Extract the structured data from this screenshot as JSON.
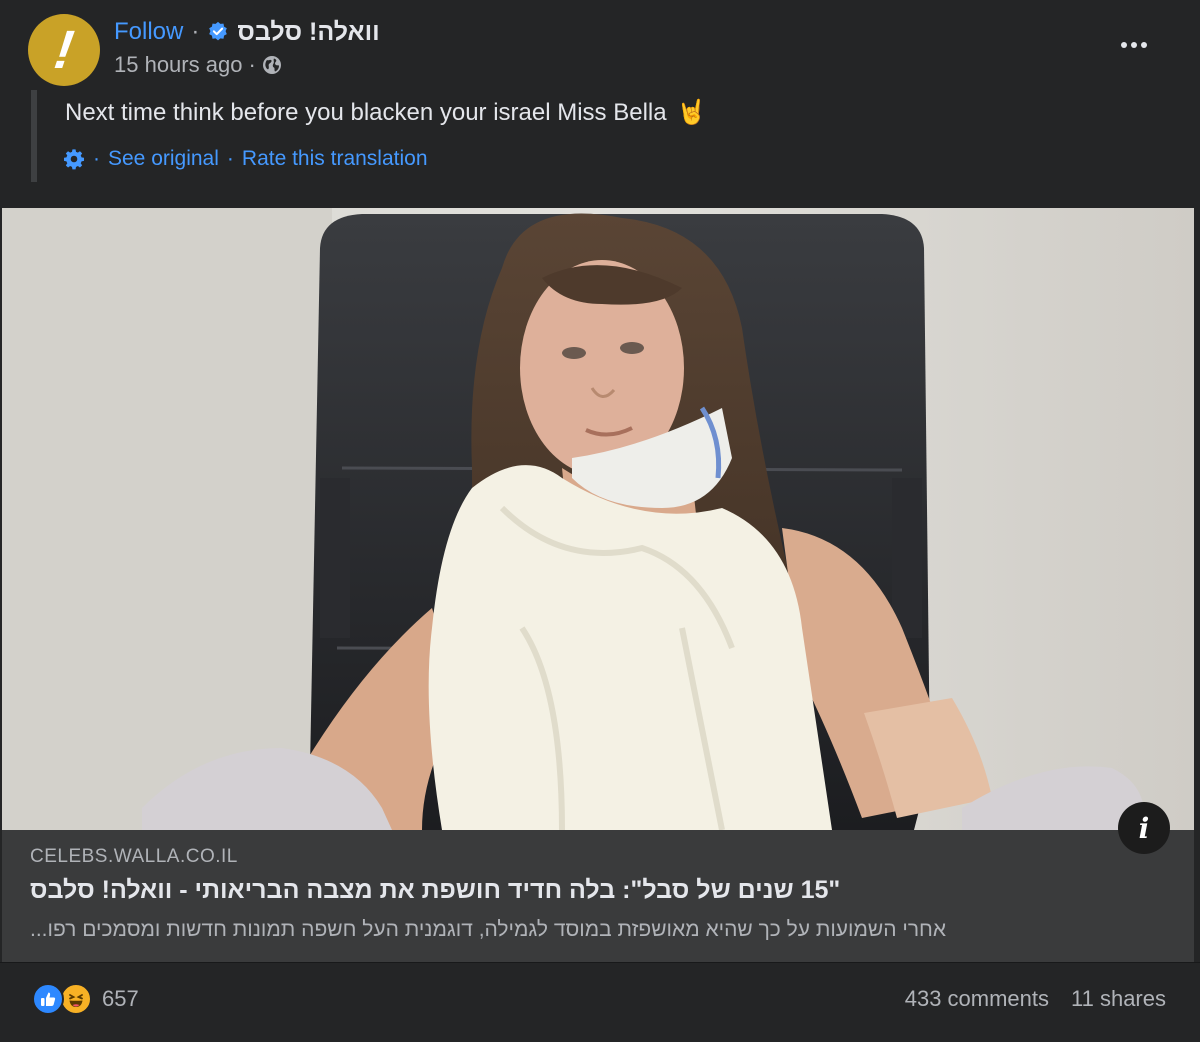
{
  "header": {
    "follow_label": "Follow",
    "separator": "·",
    "page_name": "וואלה! סלבס",
    "timestamp": "15 hours ago",
    "avatar_mark": "!"
  },
  "post": {
    "text": "Next time think before you blacken your israel Miss Bella",
    "emoji": "🤘",
    "translation": {
      "see_original": "See original",
      "rate": "Rate this translation",
      "separator": "·"
    }
  },
  "link_preview": {
    "domain": "CELEBS.WALLA.CO.IL",
    "title": "\"15 שנים של סבל\": בלה חדיד חושפת את מצבה הבריאותי - וואלה! סלבס",
    "description": "אחרי השמועות על כך שהיא מאושפזת במוסד לגמילה, דוגמנית העל חשפה תמונות חדשות ומסמכים רפו...",
    "info_label": "i"
  },
  "footer": {
    "reaction_count": "657",
    "comments": "433 comments",
    "shares": "11 shares"
  },
  "colors": {
    "background": "#242526",
    "accent_blue": "#4599ff",
    "avatar_gold": "#c9a227",
    "like_blue": "#2d88ff",
    "haha_yellow": "#f7b125"
  },
  "icons": [
    "verified-badge-icon",
    "globe-icon",
    "gear-icon",
    "more-options-icon",
    "info-icon",
    "like-reaction-icon",
    "haha-reaction-icon"
  ]
}
